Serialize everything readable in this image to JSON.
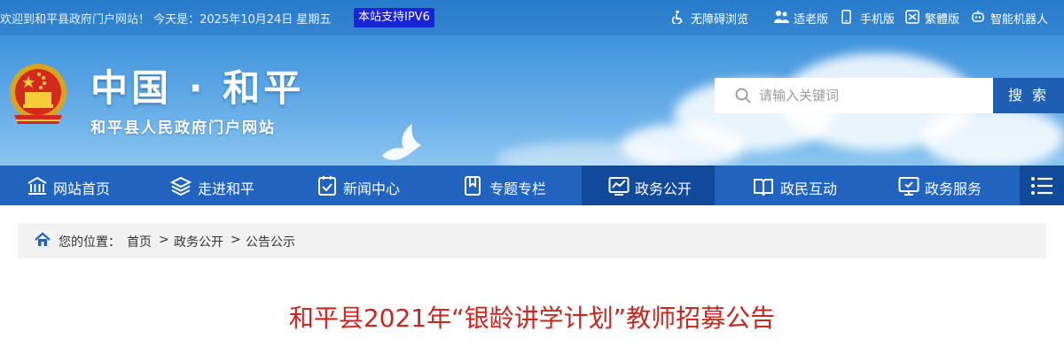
{
  "topbar": {
    "welcome": "欢迎到和平县政府门户网站！ 今天是：2025年10月24日 星期五",
    "ipv6_badge": "本站支持IPV6",
    "links": [
      {
        "label": "无障碍浏览",
        "icon": "accessibility-icon"
      },
      {
        "label": "适老版",
        "icon": "elderly-icon"
      },
      {
        "label": "手机版",
        "icon": "mobile-icon"
      },
      {
        "label": "繁體版",
        "icon": "traditional-chinese-icon"
      },
      {
        "label": "智能机器人",
        "icon": "robot-icon"
      }
    ]
  },
  "header": {
    "site_title": "中国 · 和平",
    "site_subtitle": "和平县人民政府门户网站",
    "search_placeholder": "请输入关键词",
    "search_button": "搜 索"
  },
  "nav": {
    "items": [
      {
        "label": "网站首页",
        "icon": "home-building-icon",
        "active": false
      },
      {
        "label": "走进和平",
        "icon": "layers-icon",
        "active": false
      },
      {
        "label": "新闻中心",
        "icon": "news-icon",
        "active": false
      },
      {
        "label": "专题专栏",
        "icon": "bookmark-icon",
        "active": false
      },
      {
        "label": "政务公开",
        "icon": "chart-screen-icon",
        "active": true
      },
      {
        "label": "政民互动",
        "icon": "book-icon",
        "active": false
      },
      {
        "label": "政务服务",
        "icon": "service-screen-icon",
        "active": false
      }
    ],
    "menu_icon": "menu-icon"
  },
  "breadcrumb": {
    "prefix": "您的位置：",
    "items": [
      "首页",
      "政务公开",
      "公告公示"
    ],
    "separator": ">"
  },
  "article": {
    "title": "和平县2021年“银龄讲学计划”教师招募公告",
    "title_color": "#c8261f"
  },
  "colors": {
    "nav_bg": "#2064bf",
    "nav_active": "#124a9a",
    "ipv6_bg": "#1a23d6",
    "search_button": "#1e5fb4"
  }
}
